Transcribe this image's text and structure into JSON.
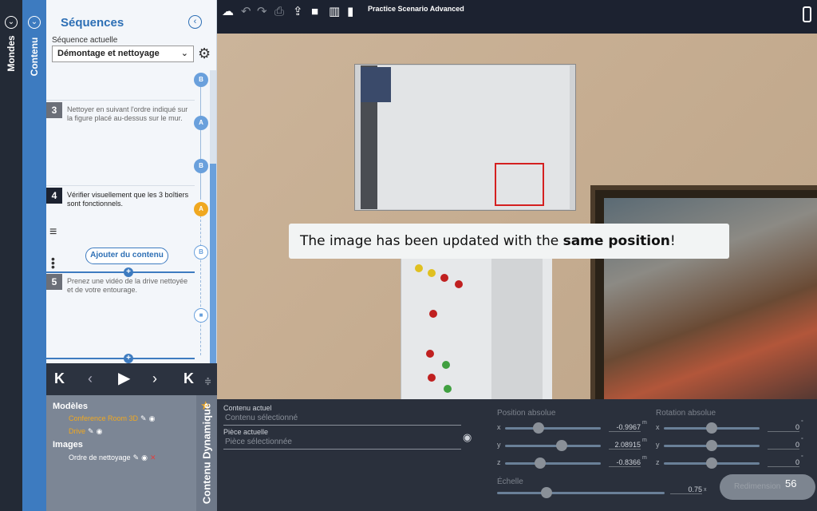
{
  "rails": {
    "mondes": "Mondes",
    "contenu": "Contenu"
  },
  "sequences": {
    "title": "Séquences",
    "current_label": "Séquence actuelle",
    "current_value": "Démontage et nettoyage",
    "steps": [
      {
        "num": "3",
        "text": "Nettoyer en suivant l'ordre indiqué sur la figure placé au-dessus sur le mur."
      },
      {
        "num": "4",
        "text": "Vérifier visuellement que les 3 boîtiers sont fonctionnels."
      },
      {
        "num": "5",
        "text": "Prenez une vidéo de la drive nettoyée et de votre entourage."
      }
    ],
    "nodes": [
      "B",
      "A",
      "B",
      "A",
      "B"
    ],
    "add_content": "Ajouter du contenu"
  },
  "models": {
    "models_head": "Modèles",
    "items": [
      "Conference Room 3D",
      "Drive"
    ],
    "images_head": "Images",
    "image_items": [
      "Ordre de nettoyage"
    ],
    "dynamic_label": "Contenu Dynamique"
  },
  "topbar": {
    "title": "Practice Scenario Advanced"
  },
  "viewport": {
    "toast_prefix": "The image has been updated with the ",
    "toast_bold": "same position",
    "toast_suffix": "!"
  },
  "props": {
    "current_content_label": "Contenu actuel",
    "current_content_value": "Contenu sélectionné",
    "current_part_label": "Pièce actuelle",
    "current_part_value": "Pièce sélectionnée",
    "position_head": "Position absolue",
    "rotation_head": "Rotation absolue",
    "scale_head": "Échelle",
    "position": [
      {
        "axis": "x",
        "value": "-0.9967",
        "unit": "m",
        "fraction": 0.33
      },
      {
        "axis": "y",
        "value": "2.08915",
        "unit": "m",
        "fraction": 0.6
      },
      {
        "axis": "z",
        "value": "-0.8366",
        "unit": "m",
        "fraction": 0.35
      }
    ],
    "rotation": [
      {
        "axis": "x",
        "value": "0",
        "unit": "°",
        "fraction": 0.5
      },
      {
        "axis": "y",
        "value": "0",
        "unit": "°",
        "fraction": 0.5
      },
      {
        "axis": "z",
        "value": "0",
        "unit": "°",
        "fraction": 0.5
      }
    ],
    "scale": {
      "value": "0.75",
      "unit": "x",
      "fraction": 0.28
    },
    "resize_button": "Redimension",
    "page_number": "56"
  }
}
